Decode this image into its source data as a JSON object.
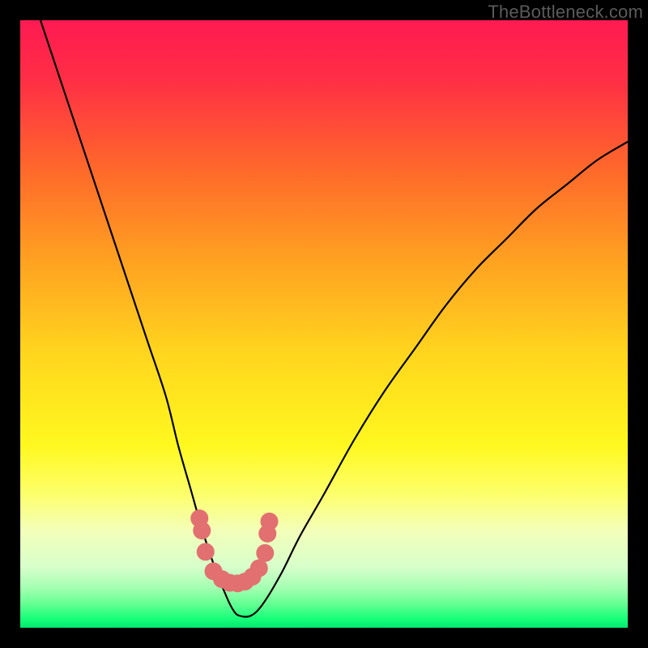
{
  "watermark": "TheBottleneck.com",
  "chart_data": {
    "type": "line",
    "title": "",
    "xlabel": "",
    "ylabel": "",
    "xlim": [
      0,
      100
    ],
    "ylim": [
      0,
      100
    ],
    "grid": false,
    "legend": false,
    "gradient_stops": [
      {
        "offset": 0.0,
        "color": "#ff1a52"
      },
      {
        "offset": 0.1,
        "color": "#ff2f45"
      },
      {
        "offset": 0.25,
        "color": "#ff6a2a"
      },
      {
        "offset": 0.4,
        "color": "#ffa321"
      },
      {
        "offset": 0.55,
        "color": "#ffd61e"
      },
      {
        "offset": 0.7,
        "color": "#fff81f"
      },
      {
        "offset": 0.78,
        "color": "#fdff6b"
      },
      {
        "offset": 0.84,
        "color": "#f3ffb9"
      },
      {
        "offset": 0.9,
        "color": "#d7ffcb"
      },
      {
        "offset": 0.935,
        "color": "#a3ffb1"
      },
      {
        "offset": 0.96,
        "color": "#66ff94"
      },
      {
        "offset": 0.985,
        "color": "#18ff7a"
      },
      {
        "offset": 1.0,
        "color": "#00e86e"
      }
    ],
    "series": [
      {
        "name": "bottleneck-curve",
        "x": [
          0,
          3,
          6,
          9,
          12,
          15,
          18,
          21,
          24,
          26,
          28,
          30,
          32,
          34,
          35,
          36,
          38,
          40,
          43,
          46,
          50,
          55,
          60,
          65,
          70,
          75,
          80,
          85,
          90,
          95,
          100
        ],
        "y": [
          110,
          101,
          92,
          83,
          74,
          65,
          56,
          47,
          38,
          30,
          23,
          16,
          10,
          5,
          3,
          2,
          2,
          4,
          9,
          15,
          22,
          31,
          39,
          46,
          53,
          59,
          64,
          69,
          73,
          77,
          80
        ]
      }
    ],
    "markers": [
      {
        "x": 29.5,
        "y": 18
      },
      {
        "x": 29.9,
        "y": 16
      },
      {
        "x": 30.5,
        "y": 12.5
      },
      {
        "x": 31.8,
        "y": 9.3
      },
      {
        "x": 33.2,
        "y": 8.0
      },
      {
        "x": 34.5,
        "y": 7.4
      },
      {
        "x": 35.8,
        "y": 7.3
      },
      {
        "x": 37.0,
        "y": 7.6
      },
      {
        "x": 38.2,
        "y": 8.4
      },
      {
        "x": 39.3,
        "y": 9.8
      },
      {
        "x": 40.3,
        "y": 12.3
      },
      {
        "x": 40.7,
        "y": 15.5
      },
      {
        "x": 41.0,
        "y": 17.5
      }
    ],
    "marker_color": "#e27070",
    "marker_radius": 11
  }
}
